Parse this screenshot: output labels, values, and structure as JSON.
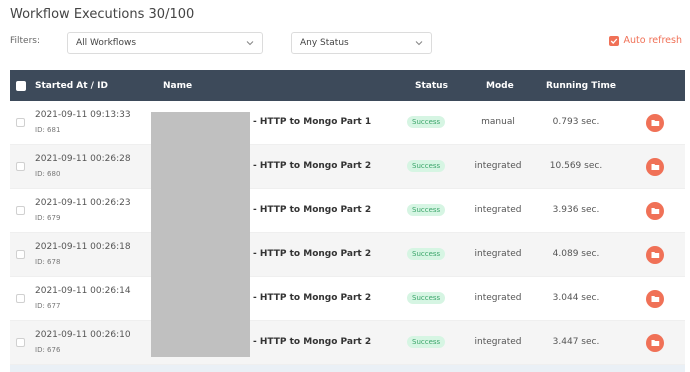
{
  "page": {
    "title": "Workflow Executions 30/100"
  },
  "filters": {
    "label": "Filters:",
    "workflow_select": "All Workflows",
    "status_select": "Any Status",
    "auto_refresh_label": "Auto refresh",
    "auto_refresh_checked": true
  },
  "table": {
    "headers": {
      "started": "Started At / ID",
      "name": "Name",
      "status": "Status",
      "mode": "Mode",
      "running_time": "Running Time"
    },
    "rows": [
      {
        "started": "2021-09-11 09:13:33",
        "id": "ID: 681",
        "name": "- HTTP to Mongo Part 1",
        "status": "Success",
        "mode": "manual",
        "running_time": "0.793 sec."
      },
      {
        "started": "2021-09-11 00:26:28",
        "id": "ID: 680",
        "name": "- HTTP to Mongo Part 2",
        "status": "Success",
        "mode": "integrated",
        "running_time": "10.569 sec."
      },
      {
        "started": "2021-09-11 00:26:23",
        "id": "ID: 679",
        "name": "- HTTP to Mongo Part 2",
        "status": "Success",
        "mode": "integrated",
        "running_time": "3.936 sec."
      },
      {
        "started": "2021-09-11 00:26:18",
        "id": "ID: 678",
        "name": "- HTTP to Mongo Part 2",
        "status": "Success",
        "mode": "integrated",
        "running_time": "4.089 sec."
      },
      {
        "started": "2021-09-11 00:26:14",
        "id": "ID: 677",
        "name": "- HTTP to Mongo Part 2",
        "status": "Success",
        "mode": "integrated",
        "running_time": "3.044 sec."
      },
      {
        "started": "2021-09-11 00:26:10",
        "id": "ID: 676",
        "name": "- HTTP to Mongo Part 2",
        "status": "Success",
        "mode": "integrated",
        "running_time": "3.447 sec."
      }
    ]
  },
  "colors": {
    "accent": "#f07157",
    "header_bg": "#3d4a5a",
    "success_bg": "#d6f5e3",
    "success_text": "#3ba56a"
  },
  "icons": {
    "row_action": "folder-open-icon",
    "dropdown": "chevron-down-icon",
    "checkbox": "check-icon"
  }
}
